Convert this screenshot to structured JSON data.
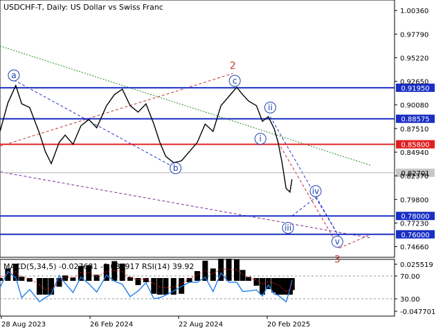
{
  "header": {
    "symbol_line": "USDCHF-T, Daily:  US Dollar vs Swiss Franc",
    "indicator_line": "MACD(5,34,5) -0.027681 -0.034917 RSI(14) 39.92"
  },
  "chart_data": {
    "type": "line",
    "title": "USDCHF-T, Daily:  US Dollar vs Swiss Franc",
    "x_ticks": [
      "28 Aug 2023",
      "26 Feb 2024",
      "22 Aug 2024",
      "20 Feb 2025"
    ],
    "price_ticks": [
      "1.00360",
      "0.97790",
      "0.95220",
      "0.92650",
      "0.90080",
      "0.87510",
      "0.84940",
      "0.82370",
      "0.79800",
      "0.77230",
      "0.74660"
    ],
    "price_tick_values": [
      1.0036,
      0.9779,
      0.9522,
      0.9265,
      0.9008,
      0.8751,
      0.8494,
      0.8237,
      0.798,
      0.7723,
      0.7466
    ],
    "ylim": [
      0.735,
      1.015
    ],
    "current_price": {
      "label": "0.82701",
      "value": 0.82701
    },
    "horizontal_levels": [
      {
        "label": "0.91950",
        "value": 0.9195,
        "color": "#1a2fc4"
      },
      {
        "label": "0.88575",
        "value": 0.88575,
        "color": "#1a2fc4"
      },
      {
        "label": "0.85800",
        "value": 0.858,
        "color": "#e02020"
      },
      {
        "label": "0.78000",
        "value": 0.78,
        "color": "#1a2fc4"
      },
      {
        "label": "0.76000",
        "value": 0.76,
        "color": "#1a2fc4"
      }
    ],
    "price_series": [
      {
        "t": 0,
        "p": 0.872
      },
      {
        "t": 0.02,
        "p": 0.903
      },
      {
        "t": 0.04,
        "p": 0.922
      },
      {
        "t": 0.055,
        "p": 0.902
      },
      {
        "t": 0.075,
        "p": 0.898
      },
      {
        "t": 0.1,
        "p": 0.87
      },
      {
        "t": 0.115,
        "p": 0.85
      },
      {
        "t": 0.13,
        "p": 0.837
      },
      {
        "t": 0.15,
        "p": 0.86
      },
      {
        "t": 0.165,
        "p": 0.868
      },
      {
        "t": 0.185,
        "p": 0.858
      },
      {
        "t": 0.205,
        "p": 0.878
      },
      {
        "t": 0.225,
        "p": 0.885
      },
      {
        "t": 0.245,
        "p": 0.876
      },
      {
        "t": 0.27,
        "p": 0.9
      },
      {
        "t": 0.29,
        "p": 0.912
      },
      {
        "t": 0.31,
        "p": 0.918
      },
      {
        "t": 0.33,
        "p": 0.9
      },
      {
        "t": 0.35,
        "p": 0.893
      },
      {
        "t": 0.37,
        "p": 0.902
      },
      {
        "t": 0.39,
        "p": 0.88
      },
      {
        "t": 0.405,
        "p": 0.86
      },
      {
        "t": 0.42,
        "p": 0.845
      },
      {
        "t": 0.44,
        "p": 0.838
      },
      {
        "t": 0.46,
        "p": 0.84
      },
      {
        "t": 0.48,
        "p": 0.85
      },
      {
        "t": 0.5,
        "p": 0.86
      },
      {
        "t": 0.52,
        "p": 0.88
      },
      {
        "t": 0.54,
        "p": 0.872
      },
      {
        "t": 0.56,
        "p": 0.9
      },
      {
        "t": 0.58,
        "p": 0.91
      },
      {
        "t": 0.6,
        "p": 0.92
      },
      {
        "t": 0.615,
        "p": 0.912
      },
      {
        "t": 0.63,
        "p": 0.905
      },
      {
        "t": 0.65,
        "p": 0.9
      },
      {
        "t": 0.665,
        "p": 0.883
      },
      {
        "t": 0.68,
        "p": 0.888
      },
      {
        "t": 0.695,
        "p": 0.875
      },
      {
        "t": 0.705,
        "p": 0.86
      },
      {
        "t": 0.715,
        "p": 0.838
      },
      {
        "t": 0.725,
        "p": 0.81
      },
      {
        "t": 0.735,
        "p": 0.806
      },
      {
        "t": 0.74,
        "p": 0.82
      }
    ],
    "wave_labels": [
      {
        "text": "a",
        "t": 0.035,
        "p": 0.933,
        "circled": true
      },
      {
        "text": "b",
        "t": 0.445,
        "p": 0.832,
        "circled": true
      },
      {
        "text": "c",
        "t": 0.595,
        "p": 0.927,
        "circled": true
      },
      {
        "text": "2",
        "t": 0.59,
        "p": 0.944,
        "circled": false
      },
      {
        "text": "ii",
        "t": 0.685,
        "p": 0.898,
        "circled": true
      },
      {
        "text": "i",
        "t": 0.66,
        "p": 0.864,
        "circled": true
      },
      {
        "text": "iii",
        "t": 0.73,
        "p": 0.767,
        "circled": true
      },
      {
        "text": "iv",
        "t": 0.8,
        "p": 0.807,
        "circled": true
      },
      {
        "text": "v",
        "t": 0.855,
        "p": 0.752,
        "circled": true
      },
      {
        "text": "3",
        "t": 0.855,
        "p": 0.733,
        "circled": false
      }
    ],
    "trend_lines": [
      {
        "style": "dotted",
        "color": "#1f8a1f",
        "from": {
          "t": 0.0,
          "p": 0.965
        },
        "to": {
          "t": 0.94,
          "p": 0.835
        }
      },
      {
        "style": "dashed",
        "color": "#2233cc",
        "from": {
          "t": 0.035,
          "p": 0.928
        },
        "to": {
          "t": 0.445,
          "p": 0.832
        }
      },
      {
        "style": "dashed",
        "color": "#c03030",
        "from": {
          "t": 0.0,
          "p": 0.856
        },
        "to": {
          "t": 0.59,
          "p": 0.935
        }
      },
      {
        "style": "dashed",
        "color": "#7a2a9a",
        "from": {
          "t": 0.0,
          "p": 0.828
        },
        "to": {
          "t": 0.94,
          "p": 0.756
        }
      },
      {
        "style": "dashed",
        "color": "#c03030",
        "from": {
          "t": 0.705,
          "p": 0.86
        },
        "to": {
          "t": 0.86,
          "p": 0.745
        }
      },
      {
        "style": "dashed",
        "color": "#2233cc",
        "from": {
          "t": 0.685,
          "p": 0.888
        },
        "to": {
          "t": 0.86,
          "p": 0.757
        }
      },
      {
        "style": "dashed",
        "color": "#2233cc",
        "from": {
          "t": 0.74,
          "p": 0.78
        },
        "to": {
          "t": 0.8,
          "p": 0.8
        }
      },
      {
        "style": "dashed",
        "color": "#2233cc",
        "from": {
          "t": 0.8,
          "p": 0.8
        },
        "to": {
          "t": 0.86,
          "p": 0.757
        }
      },
      {
        "style": "dashed",
        "color": "#c03030",
        "from": {
          "t": 0.86,
          "p": 0.745
        },
        "to": {
          "t": 0.94,
          "p": 0.76
        }
      }
    ],
    "indicator": {
      "ticks": [
        "0.025519",
        "70.00",
        "30.00",
        "-0.047701"
      ],
      "tick_values": [
        0.025519,
        70,
        30,
        -0.047701
      ],
      "macd_zero_line": 0.0,
      "rsi_levels": [
        70,
        30
      ]
    },
    "colors": {
      "price": "#000000",
      "histogram": "#000000",
      "rsi": "#1e7ee8",
      "macd_signal": "#e02020",
      "axis": "#000000",
      "current_price_box": "#c8c8c8"
    }
  }
}
